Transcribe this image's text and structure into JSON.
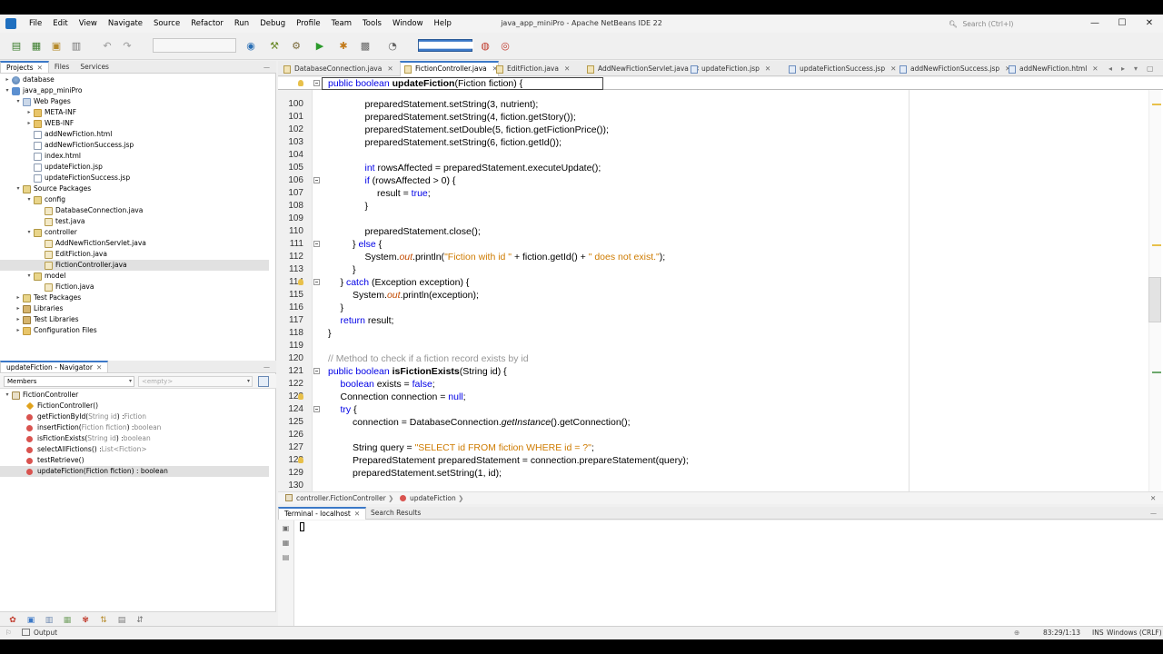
{
  "window": {
    "title": "java_app_miniPro - Apache NetBeans IDE 22",
    "search_placeholder": "Search (Ctrl+I)",
    "controls": {
      "minimize": "—",
      "maximize": "☐",
      "close": "✕"
    }
  },
  "menu": [
    "File",
    "Edit",
    "View",
    "Navigate",
    "Source",
    "Refactor",
    "Run",
    "Debug",
    "Profile",
    "Team",
    "Tools",
    "Window",
    "Help"
  ],
  "toolbar": {
    "memory_label": "████████████"
  },
  "projects_panel": {
    "tabs": [
      "Projects",
      "Files",
      "Services"
    ],
    "tree": [
      {
        "label": "database",
        "depth": 0,
        "icon": "db",
        "toggle": "▸"
      },
      {
        "label": "java_app_miniPro",
        "depth": 0,
        "icon": "proj",
        "toggle": "▾"
      },
      {
        "label": "Web Pages",
        "depth": 1,
        "icon": "web",
        "toggle": "▾"
      },
      {
        "label": "META-INF",
        "depth": 2,
        "icon": "folder",
        "toggle": "▸"
      },
      {
        "label": "WEB-INF",
        "depth": 2,
        "icon": "folder",
        "toggle": "▸"
      },
      {
        "label": "addNewFiction.html",
        "depth": 2,
        "icon": "file",
        "toggle": ""
      },
      {
        "label": "addNewFictionSuccess.jsp",
        "depth": 2,
        "icon": "file",
        "toggle": ""
      },
      {
        "label": "index.html",
        "depth": 2,
        "icon": "file",
        "toggle": ""
      },
      {
        "label": "updateFiction.jsp",
        "depth": 2,
        "icon": "file",
        "toggle": ""
      },
      {
        "label": "updateFictionSuccess.jsp",
        "depth": 2,
        "icon": "file",
        "toggle": ""
      },
      {
        "label": "Source Packages",
        "depth": 1,
        "icon": "pkg",
        "toggle": "▾"
      },
      {
        "label": "config",
        "depth": 2,
        "icon": "pkg",
        "toggle": "▾"
      },
      {
        "label": "DatabaseConnection.java",
        "depth": 3,
        "icon": "java",
        "toggle": ""
      },
      {
        "label": "test.java",
        "depth": 3,
        "icon": "java",
        "toggle": ""
      },
      {
        "label": "controller",
        "depth": 2,
        "icon": "pkg",
        "toggle": "▾"
      },
      {
        "label": "AddNewFictionServlet.java",
        "depth": 3,
        "icon": "java",
        "toggle": ""
      },
      {
        "label": "EditFiction.java",
        "depth": 3,
        "icon": "java",
        "toggle": ""
      },
      {
        "label": "FictionController.java",
        "depth": 3,
        "icon": "java",
        "toggle": "",
        "selected": true
      },
      {
        "label": "model",
        "depth": 2,
        "icon": "pkg",
        "toggle": "▾"
      },
      {
        "label": "Fiction.java",
        "depth": 3,
        "icon": "java",
        "toggle": ""
      },
      {
        "label": "Test Packages",
        "depth": 1,
        "icon": "pkg",
        "toggle": "▸"
      },
      {
        "label": "Libraries",
        "depth": 1,
        "icon": "lib",
        "toggle": "▸"
      },
      {
        "label": "Test Libraries",
        "depth": 1,
        "icon": "lib",
        "toggle": "▸"
      },
      {
        "label": "Configuration Files",
        "depth": 1,
        "icon": "folder",
        "toggle": "▸"
      }
    ]
  },
  "navigator": {
    "tab": "updateFiction - Navigator",
    "filter_value": "Members",
    "search_placeholder": "<empty>",
    "items": [
      {
        "name": "FictionController",
        "sig": "",
        "kind": "class"
      },
      {
        "name": "FictionController()",
        "sig": "",
        "kind": "ctor"
      },
      {
        "name": "getFictionById(",
        "param": "String id",
        "tail": ") : ",
        "ret": "Fiction",
        "kind": "method"
      },
      {
        "name": "insertFiction(",
        "param": "Fiction fiction",
        "tail": ") : ",
        "ret": "boolean",
        "kind": "method"
      },
      {
        "name": "isFictionExists(",
        "param": "String id",
        "tail": ") : ",
        "ret": "boolean",
        "kind": "method"
      },
      {
        "name": "selectAllFictions() : ",
        "param": "",
        "tail": "",
        "ret": "List<Fiction>",
        "kind": "method"
      },
      {
        "name": "testRetrieve()",
        "param": "",
        "tail": "",
        "ret": "",
        "kind": "method"
      },
      {
        "name": "updateFiction(Fiction fiction) : boolean",
        "param": "",
        "tail": "",
        "ret": "",
        "kind": "method",
        "selected": true
      }
    ]
  },
  "editor_tabs": [
    {
      "label": "DatabaseConnection.java",
      "type": "java"
    },
    {
      "label": "FictionController.java",
      "type": "java",
      "active": true
    },
    {
      "label": "EditFiction.java",
      "type": "java"
    },
    {
      "label": "AddNewFictionServlet.java",
      "type": "java"
    },
    {
      "label": "updateFiction.jsp",
      "type": "jsp"
    },
    {
      "label": "updateFictionSuccess.jsp",
      "type": "jsp"
    },
    {
      "label": "addNewFictionSuccess.jsp",
      "type": "jsp"
    },
    {
      "label": "addNewFiction.html",
      "type": "jsp"
    }
  ],
  "editor": {
    "sticky_header": [
      {
        "t": "public boolean ",
        "c": "kw"
      },
      {
        "t": "updateFiction",
        "c": "bd"
      },
      {
        "t": "(Fiction fiction) {",
        "c": ""
      }
    ],
    "lines": [
      {
        "n": "100",
        "indent": 3,
        "fold": false,
        "parts": [
          {
            "t": "preparedStatement.setString(3, nutrient);",
            "c": ""
          }
        ]
      },
      {
        "n": "101",
        "indent": 3,
        "fold": false,
        "parts": [
          {
            "t": "preparedStatement.setString(4, fiction.getStory());",
            "c": ""
          }
        ]
      },
      {
        "n": "102",
        "indent": 3,
        "fold": false,
        "parts": [
          {
            "t": "preparedStatement.setDouble(5, fiction.getFictionPrice());",
            "c": ""
          }
        ]
      },
      {
        "n": "103",
        "indent": 3,
        "fold": false,
        "parts": [
          {
            "t": "preparedStatement.setString(6, fiction.getId());",
            "c": ""
          }
        ]
      },
      {
        "n": "104",
        "indent": 3,
        "fold": false,
        "parts": []
      },
      {
        "n": "105",
        "indent": 3,
        "fold": false,
        "parts": [
          {
            "t": "int",
            "c": "kw"
          },
          {
            "t": " rowsAffected = preparedStatement.executeUpdate();",
            "c": ""
          }
        ]
      },
      {
        "n": "106",
        "indent": 3,
        "fold": true,
        "parts": [
          {
            "t": "if",
            "c": "kw"
          },
          {
            "t": " (rowsAffected > 0) {",
            "c": ""
          }
        ]
      },
      {
        "n": "107",
        "indent": 4,
        "fold": false,
        "parts": [
          {
            "t": "result = ",
            "c": ""
          },
          {
            "t": "true",
            "c": "kw"
          },
          {
            "t": ";",
            "c": ""
          }
        ]
      },
      {
        "n": "108",
        "indent": 3,
        "fold": false,
        "parts": [
          {
            "t": "}",
            "c": ""
          }
        ]
      },
      {
        "n": "109",
        "indent": 3,
        "fold": false,
        "parts": []
      },
      {
        "n": "110",
        "indent": 3,
        "fold": false,
        "parts": [
          {
            "t": "preparedStatement.close();",
            "c": ""
          }
        ]
      },
      {
        "n": "111",
        "indent": 2,
        "fold": true,
        "parts": [
          {
            "t": "} ",
            "c": ""
          },
          {
            "t": "else",
            "c": "kw"
          },
          {
            "t": " {",
            "c": ""
          }
        ]
      },
      {
        "n": "112",
        "indent": 3,
        "fold": false,
        "parts": [
          {
            "t": "System.",
            "c": ""
          },
          {
            "t": "out",
            "c": "itk"
          },
          {
            "t": ".println(",
            "c": ""
          },
          {
            "t": "\"Fiction with id \"",
            "c": "str"
          },
          {
            "t": " + fiction.getId() + ",
            "c": ""
          },
          {
            "t": "\" does not exist.\"",
            "c": "str"
          },
          {
            "t": ");",
            "c": ""
          }
        ]
      },
      {
        "n": "113",
        "indent": 2,
        "fold": false,
        "parts": [
          {
            "t": "}",
            "c": ""
          }
        ]
      },
      {
        "n": "114",
        "indent": 1,
        "fold": true,
        "bulb": true,
        "parts": [
          {
            "t": "} ",
            "c": ""
          },
          {
            "t": "catch",
            "c": "kw"
          },
          {
            "t": " (Exception exception) {",
            "c": ""
          }
        ]
      },
      {
        "n": "115",
        "indent": 2,
        "fold": false,
        "parts": [
          {
            "t": "System.",
            "c": ""
          },
          {
            "t": "out",
            "c": "itk"
          },
          {
            "t": ".println(exception);",
            "c": ""
          }
        ]
      },
      {
        "n": "116",
        "indent": 1,
        "fold": false,
        "parts": [
          {
            "t": "}",
            "c": ""
          }
        ]
      },
      {
        "n": "117",
        "indent": 1,
        "fold": false,
        "parts": [
          {
            "t": "return",
            "c": "kw"
          },
          {
            "t": " result;",
            "c": ""
          }
        ]
      },
      {
        "n": "118",
        "indent": 0,
        "fold": false,
        "parts": [
          {
            "t": "}",
            "c": ""
          }
        ]
      },
      {
        "n": "119",
        "indent": 0,
        "fold": false,
        "parts": []
      },
      {
        "n": "120",
        "indent": 0,
        "fold": false,
        "parts": [
          {
            "t": "// Method to check if a fiction record exists by id",
            "c": "cm"
          }
        ]
      },
      {
        "n": "121",
        "indent": 0,
        "fold": true,
        "parts": [
          {
            "t": "public boolean ",
            "c": "kw"
          },
          {
            "t": "isFictionExists",
            "c": "bd"
          },
          {
            "t": "(String id) {",
            "c": ""
          }
        ]
      },
      {
        "n": "122",
        "indent": 1,
        "fold": false,
        "parts": [
          {
            "t": "boolean",
            "c": "kw"
          },
          {
            "t": " exists = ",
            "c": ""
          },
          {
            "t": "false",
            "c": "kw"
          },
          {
            "t": ";",
            "c": ""
          }
        ]
      },
      {
        "n": "123",
        "indent": 1,
        "fold": false,
        "bulb": true,
        "parts": [
          {
            "t": "Connection connection = ",
            "c": ""
          },
          {
            "t": "null",
            "c": "kw"
          },
          {
            "t": ";",
            "c": ""
          }
        ]
      },
      {
        "n": "124",
        "indent": 1,
        "fold": true,
        "parts": [
          {
            "t": "try",
            "c": "kw"
          },
          {
            "t": " {",
            "c": ""
          }
        ]
      },
      {
        "n": "125",
        "indent": 2,
        "fold": false,
        "parts": [
          {
            "t": "connection = DatabaseConnection.",
            "c": ""
          },
          {
            "t": "getInstance",
            "c": "it"
          },
          {
            "t": "().getConnection();",
            "c": ""
          }
        ]
      },
      {
        "n": "126",
        "indent": 2,
        "fold": false,
        "parts": []
      },
      {
        "n": "127",
        "indent": 2,
        "fold": false,
        "parts": [
          {
            "t": "String query = ",
            "c": ""
          },
          {
            "t": "\"SELECT id FROM fiction WHERE id = ?\"",
            "c": "str"
          },
          {
            "t": ";",
            "c": ""
          }
        ]
      },
      {
        "n": "128",
        "indent": 2,
        "fold": false,
        "bulb": true,
        "parts": [
          {
            "t": "PreparedStatement preparedStatement = connection.prepareStatement(query);",
            "c": ""
          }
        ]
      },
      {
        "n": "129",
        "indent": 2,
        "fold": false,
        "parts": [
          {
            "t": "preparedStatement.setString(1, id);",
            "c": ""
          }
        ]
      },
      {
        "n": "130",
        "indent": 2,
        "fold": false,
        "parts": []
      }
    ]
  },
  "breadcrumb": [
    "controller.FictionController",
    "updateFiction"
  ],
  "output_tabs": [
    {
      "label": "Terminal - localhost",
      "active": true
    },
    {
      "label": "Search Results",
      "active": false
    }
  ],
  "status": {
    "output_label": "Output",
    "position": "83:29/1:13",
    "mode": "INS",
    "line_endings": "Windows (CRLF)"
  }
}
